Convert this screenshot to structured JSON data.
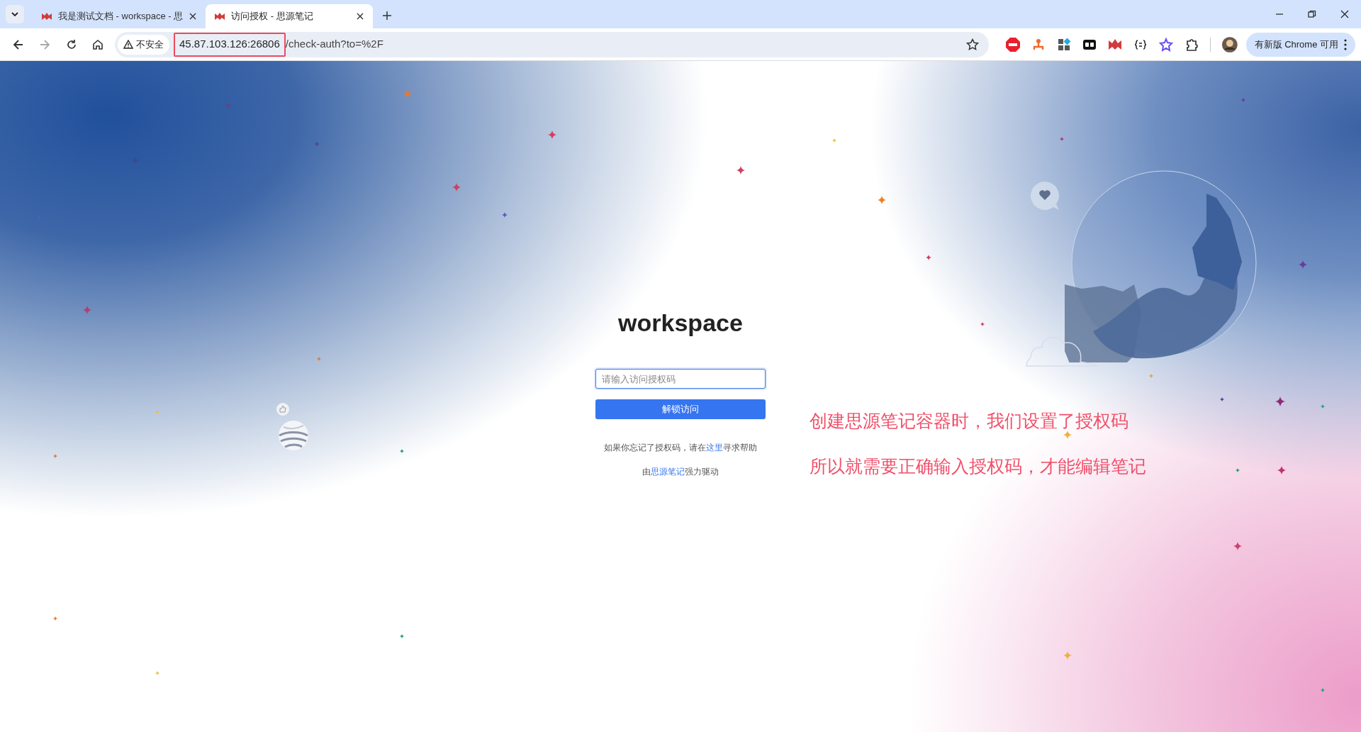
{
  "browser": {
    "tabs": [
      {
        "title": "我是测试文档 - workspace - 思",
        "selected": false
      },
      {
        "title": "访问授权 - 思源笔记",
        "selected": true
      }
    ],
    "address_bar": {
      "security_label": "不安全",
      "url_host": "45.87.103.126:26806",
      "url_path": "/check-auth?to=%2F"
    },
    "update_button": "有新版 Chrome 可用"
  },
  "page": {
    "title": "workspace",
    "code_field": {
      "placeholder": "请输入访问授权码"
    },
    "unlock_button": "解锁访问",
    "help_text": {
      "before": "如果你忘记了授权码，请在",
      "link": "这里",
      "after": "寻求帮助"
    },
    "powered_by": {
      "before": "由",
      "link": "思源笔记",
      "after": "强力驱动"
    }
  },
  "annotations": [
    "创建思源笔记容器时，我们设置了授权码",
    "所以就需要正确输入授权码，才能编辑笔记"
  ]
}
